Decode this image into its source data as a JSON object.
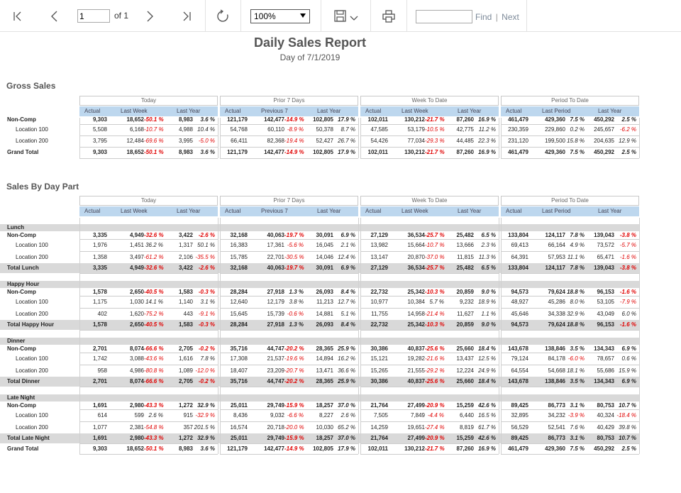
{
  "toolbar": {
    "page_value": "1",
    "page_of": "of 1",
    "zoom": "100%",
    "find_label": "Find",
    "find_sep": "|",
    "next_label": "Next"
  },
  "report": {
    "title": "Daily Sales Report",
    "subtitle": "Day of 7/1/2019",
    "groups": [
      {
        "name": "Today",
        "subs": [
          "Actual",
          "Last Week",
          "Last Year"
        ]
      },
      {
        "name": "Prior 7 Days",
        "subs": [
          "Actual",
          "Previous 7",
          "Last Year"
        ]
      },
      {
        "name": "Week To Date",
        "subs": [
          "Actual",
          "Last Week",
          "Last Year"
        ]
      },
      {
        "name": "Period To Date",
        "subs": [
          "Actual",
          "Last Period",
          "Last Year"
        ]
      }
    ]
  },
  "sections": [
    {
      "title": "Gross Sales",
      "rows": [
        {
          "label": "Non-Comp",
          "type": "bold",
          "vals": [
            "9,303",
            "18,652",
            "-50.1 %",
            "8,983",
            "3.6 %",
            "121,179",
            "142,477",
            "-14.9 %",
            "102,805",
            "17.9 %",
            "102,011",
            "130,212",
            "-21.7 %",
            "87,260",
            "16.9 %",
            "461,479",
            "429,360",
            "7.5 %",
            "450,292",
            "2.5 %"
          ]
        },
        {
          "label": "Location 100",
          "type": "loc",
          "vals": [
            "5,508",
            "6,168",
            "-10.7 %",
            "4,988",
            "10.4 %",
            "54,768",
            "60,110",
            "-8.9 %",
            "50,378",
            "8.7 %",
            "47,585",
            "53,179",
            "-10.5 %",
            "42,775",
            "11.2 %",
            "230,359",
            "229,860",
            "0.2 %",
            "245,657",
            "-6.2 %"
          ]
        },
        {
          "label": "Location 200",
          "type": "loc",
          "vals": [
            "3,795",
            "12,484",
            "-69.6 %",
            "3,995",
            "-5.0 %",
            "66,411",
            "82,368",
            "-19.4 %",
            "52,427",
            "26.7 %",
            "54,426",
            "77,034",
            "-29.3 %",
            "44,485",
            "22.3 %",
            "231,120",
            "199,500",
            "15.8 %",
            "204,635",
            "12.9 %"
          ]
        },
        {
          "label": "Grand Total",
          "type": "total",
          "vals": [
            "9,303",
            "18,652",
            "-50.1 %",
            "8,983",
            "3.6 %",
            "121,179",
            "142,477",
            "-14.9 %",
            "102,805",
            "17.9 %",
            "102,011",
            "130,212",
            "-21.7 %",
            "87,260",
            "16.9 %",
            "461,479",
            "429,360",
            "7.5 %",
            "450,292",
            "2.5 %"
          ]
        }
      ]
    },
    {
      "title": "Sales By Day Part",
      "rows": [
        {
          "label": "Lunch",
          "type": "group"
        },
        {
          "label": "Non-Comp",
          "type": "bold",
          "vals": [
            "3,335",
            "4,949",
            "-32.6 %",
            "3,422",
            "-2.6 %",
            "32,168",
            "40,063",
            "-19.7 %",
            "30,091",
            "6.9 %",
            "27,129",
            "36,534",
            "-25.7 %",
            "25,482",
            "6.5 %",
            "133,804",
            "124,117",
            "7.8 %",
            "139,043",
            "-3.8 %"
          ]
        },
        {
          "label": "Location 100",
          "type": "loc",
          "vals": [
            "1,976",
            "1,451",
            "36.2 %",
            "1,317",
            "50.1 %",
            "16,383",
            "17,361",
            "-5.6 %",
            "16,045",
            "2.1 %",
            "13,982",
            "15,664",
            "-10.7 %",
            "13,666",
            "2.3 %",
            "69,413",
            "66,164",
            "4.9 %",
            "73,572",
            "-5.7 %"
          ]
        },
        {
          "label": "Location 200",
          "type": "loc",
          "vals": [
            "1,358",
            "3,497",
            "-61.2 %",
            "2,106",
            "-35.5 %",
            "15,785",
            "22,701",
            "-30.5 %",
            "14,046",
            "12.4 %",
            "13,147",
            "20,870",
            "-37.0 %",
            "11,815",
            "11.3 %",
            "64,391",
            "57,953",
            "11.1 %",
            "65,471",
            "-1.6 %"
          ]
        },
        {
          "label": "Total Lunch",
          "type": "total",
          "vals": [
            "3,335",
            "4,949",
            "-32.6 %",
            "3,422",
            "-2.6 %",
            "32,168",
            "40,063",
            "-19.7 %",
            "30,091",
            "6.9 %",
            "27,129",
            "36,534",
            "-25.7 %",
            "25,482",
            "6.5 %",
            "133,804",
            "124,117",
            "7.8 %",
            "139,043",
            "-3.8 %"
          ]
        },
        {
          "label": "Happy Hour",
          "type": "group"
        },
        {
          "label": "Non-Comp",
          "type": "bold",
          "vals": [
            "1,578",
            "2,650",
            "-40.5 %",
            "1,583",
            "-0.3 %",
            "28,284",
            "27,918",
            "1.3 %",
            "26,093",
            "8.4 %",
            "22,732",
            "25,342",
            "-10.3 %",
            "20,859",
            "9.0 %",
            "94,573",
            "79,624",
            "18.8 %",
            "96,153",
            "-1.6 %"
          ]
        },
        {
          "label": "Location 100",
          "type": "loc",
          "vals": [
            "1,175",
            "1,030",
            "14.1 %",
            "1,140",
            "3.1 %",
            "12,640",
            "12,179",
            "3.8 %",
            "11,213",
            "12.7 %",
            "10,977",
            "10,384",
            "5.7 %",
            "9,232",
            "18.9 %",
            "48,927",
            "45,286",
            "8.0 %",
            "53,105",
            "-7.9 %"
          ]
        },
        {
          "label": "Location 200",
          "type": "loc",
          "vals": [
            "402",
            "1,620",
            "-75.2 %",
            "443",
            "-9.1 %",
            "15,645",
            "15,739",
            "-0.6 %",
            "14,881",
            "5.1 %",
            "11,755",
            "14,958",
            "-21.4 %",
            "11,627",
            "1.1 %",
            "45,646",
            "34,338",
            "32.9 %",
            "43,049",
            "6.0 %"
          ]
        },
        {
          "label": "Total Happy Hour",
          "type": "total",
          "vals": [
            "1,578",
            "2,650",
            "-40.5 %",
            "1,583",
            "-0.3 %",
            "28,284",
            "27,918",
            "1.3 %",
            "26,093",
            "8.4 %",
            "22,732",
            "25,342",
            "-10.3 %",
            "20,859",
            "9.0 %",
            "94,573",
            "79,624",
            "18.8 %",
            "96,153",
            "-1.6 %"
          ]
        },
        {
          "label": "Dinner",
          "type": "group"
        },
        {
          "label": "Non-Comp",
          "type": "bold",
          "vals": [
            "2,701",
            "8,074",
            "-66.6 %",
            "2,705",
            "-0.2 %",
            "35,716",
            "44,747",
            "-20.2 %",
            "28,365",
            "25.9 %",
            "30,386",
            "40,837",
            "-25.6 %",
            "25,660",
            "18.4 %",
            "143,678",
            "138,846",
            "3.5 %",
            "134,343",
            "6.9 %"
          ]
        },
        {
          "label": "Location 100",
          "type": "loc",
          "vals": [
            "1,742",
            "3,088",
            "-43.6 %",
            "1,616",
            "7.8 %",
            "17,308",
            "21,537",
            "-19.6 %",
            "14,894",
            "16.2 %",
            "15,121",
            "19,282",
            "-21.6 %",
            "13,437",
            "12.5 %",
            "79,124",
            "84,178",
            "-6.0 %",
            "78,657",
            "0.6 %"
          ]
        },
        {
          "label": "Location 200",
          "type": "loc",
          "vals": [
            "958",
            "4,986",
            "-80.8 %",
            "1,089",
            "-12.0 %",
            "18,407",
            "23,209",
            "-20.7 %",
            "13,471",
            "36.6 %",
            "15,265",
            "21,555",
            "-29.2 %",
            "12,224",
            "24.9 %",
            "64,554",
            "54,668",
            "18.1 %",
            "55,686",
            "15.9 %"
          ]
        },
        {
          "label": "Total Dinner",
          "type": "total",
          "vals": [
            "2,701",
            "8,074",
            "-66.6 %",
            "2,705",
            "-0.2 %",
            "35,716",
            "44,747",
            "-20.2 %",
            "28,365",
            "25.9 %",
            "30,386",
            "40,837",
            "-25.6 %",
            "25,660",
            "18.4 %",
            "143,678",
            "138,846",
            "3.5 %",
            "134,343",
            "6.9 %"
          ]
        },
        {
          "label": "Late Night",
          "type": "group"
        },
        {
          "label": "Non-Comp",
          "type": "bold",
          "vals": [
            "1,691",
            "2,980",
            "-43.3 %",
            "1,272",
            "32.9 %",
            "25,011",
            "29,749",
            "-15.9 %",
            "18,257",
            "37.0 %",
            "21,764",
            "27,499",
            "-20.9 %",
            "15,259",
            "42.6 %",
            "89,425",
            "86,773",
            "3.1 %",
            "80,753",
            "10.7 %"
          ]
        },
        {
          "label": "Location 100",
          "type": "loc",
          "vals": [
            "614",
            "599",
            "2.6 %",
            "915",
            "-32.9 %",
            "8,436",
            "9,032",
            "-6.6 %",
            "8,227",
            "2.6 %",
            "7,505",
            "7,849",
            "-4.4 %",
            "6,440",
            "16.5 %",
            "32,895",
            "34,232",
            "-3.9 %",
            "40,324",
            "-18.4 %"
          ]
        },
        {
          "label": "Location 200",
          "type": "loc",
          "vals": [
            "1,077",
            "2,381",
            "-54.8 %",
            "357",
            "201.5 %",
            "16,574",
            "20,718",
            "-20.0 %",
            "10,030",
            "65.2 %",
            "14,259",
            "19,651",
            "-27.4 %",
            "8,819",
            "61.7 %",
            "56,529",
            "52,541",
            "7.6 %",
            "40,429",
            "39.8 %"
          ]
        },
        {
          "label": "Total Late Night",
          "type": "total",
          "vals": [
            "1,691",
            "2,980",
            "-43.3 %",
            "1,272",
            "32.9 %",
            "25,011",
            "29,749",
            "-15.9 %",
            "18,257",
            "37.0 %",
            "21,764",
            "27,499",
            "-20.9 %",
            "15,259",
            "42.6 %",
            "89,425",
            "86,773",
            "3.1 %",
            "80,753",
            "10.7 %"
          ]
        },
        {
          "label": "Grand Total",
          "type": "grand",
          "vals": [
            "9,303",
            "18,652",
            "-50.1 %",
            "8,983",
            "3.6 %",
            "121,179",
            "142,477",
            "-14.9 %",
            "102,805",
            "17.9 %",
            "102,011",
            "130,212",
            "-21.7 %",
            "87,260",
            "16.9 %",
            "461,479",
            "429,360",
            "7.5 %",
            "450,292",
            "2.5 %"
          ]
        }
      ]
    }
  ],
  "colors": {
    "negative": "#e00000",
    "subheader_bg": "#bdd7ee",
    "band_bg": "#d9d9d9"
  }
}
